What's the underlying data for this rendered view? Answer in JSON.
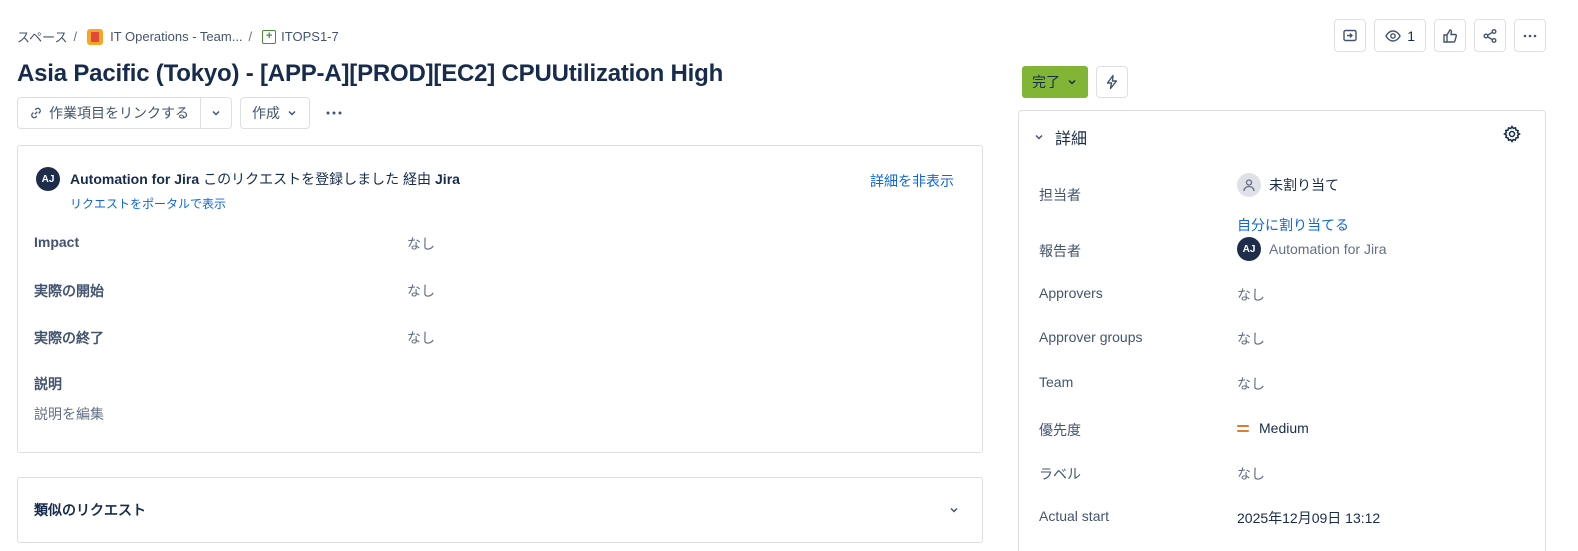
{
  "breadcrumb": {
    "spaces": "スペース",
    "project": "IT Operations - Team...",
    "issue_key": "ITOPS1-7"
  },
  "header_actions": {
    "watch_count": "1",
    "icons": [
      "feedback-icon",
      "eye-icon",
      "thumbs-up-icon",
      "share-icon",
      "more-icon"
    ]
  },
  "title": "Asia Pacific (Tokyo) - [APP-A][PROD][EC2] CPUUtilization High",
  "toolbar": {
    "link_label": "作業項目をリンクする",
    "create_label": "作成"
  },
  "request": {
    "avatar_initials": "AJ",
    "reporter_name": "Automation for Jira",
    "action_text": "このリクエストを登録しました 経由",
    "channel": "Jira",
    "portal_link": "リクエストをポータルで表示",
    "hide_details": "詳細を非表示",
    "fields": [
      {
        "label": "Impact",
        "value": "なし"
      },
      {
        "label": "実際の開始",
        "value": "なし"
      },
      {
        "label": "実際の終了",
        "value": "なし"
      }
    ],
    "description_label": "説明",
    "description_edit": "説明を編集"
  },
  "similar": {
    "label": "類似のリクエスト"
  },
  "status": {
    "label": "完了",
    "color": "#82b536"
  },
  "details": {
    "header": "詳細",
    "assignee_label": "担当者",
    "assignee_value": "未割り当て",
    "assign_self": "自分に割り当てる",
    "reporter_label": "報告者",
    "reporter_avatar": "AJ",
    "reporter_value": "Automation for Jira",
    "approvers_label": "Approvers",
    "approvers_value": "なし",
    "approver_groups_label": "Approver groups",
    "approver_groups_value": "なし",
    "team_label": "Team",
    "team_value": "なし",
    "priority_label": "優先度",
    "priority_value": "Medium",
    "priority_color": "#e07a2e",
    "labels_label": "ラベル",
    "labels_value": "なし",
    "actual_start_label": "Actual start",
    "actual_start_value": "2025年12月09日 13:12"
  }
}
